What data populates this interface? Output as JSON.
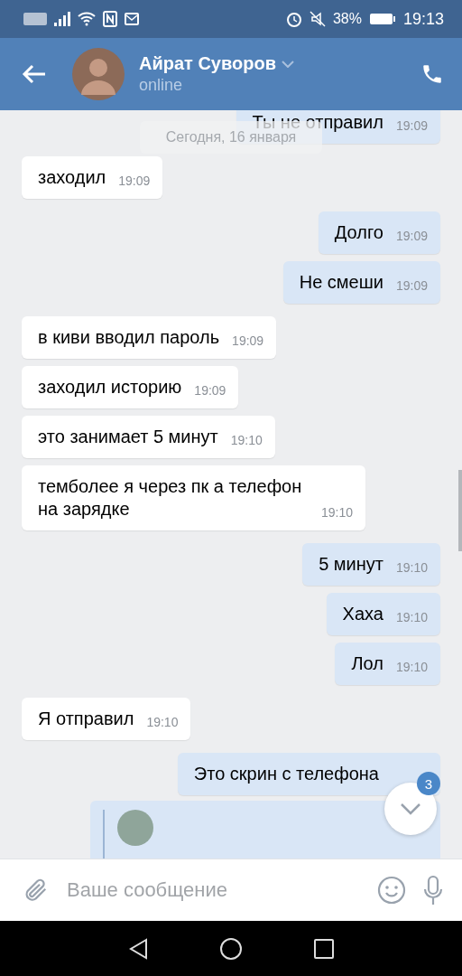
{
  "status_bar": {
    "battery": "38%",
    "time": "19:13"
  },
  "header": {
    "name": "Айрат Суворов",
    "status": "online"
  },
  "date_pill": "Сегодня, 16 января",
  "messages": [
    {
      "kind": "outgoing",
      "text": "Ты не отправил",
      "time": "19:09"
    },
    {
      "kind": "incoming",
      "text": "заходил",
      "time": "19:09"
    },
    {
      "kind": "outgoing",
      "text": "Долго",
      "time": "19:09"
    },
    {
      "kind": "outgoing",
      "text": "Не смеши",
      "time": "19:09"
    },
    {
      "kind": "incoming",
      "text": "в киви вводил пароль",
      "time": "19:09"
    },
    {
      "kind": "incoming",
      "text": "заходил историю",
      "time": "19:09"
    },
    {
      "kind": "incoming",
      "text": "это занимает 5 минут",
      "time": "19:10"
    },
    {
      "kind": "incoming",
      "text": "темболее я через пк а телефон на зарядке",
      "time": "19:10"
    },
    {
      "kind": "outgoing",
      "text": "5 минут",
      "time": "19:10"
    },
    {
      "kind": "outgoing",
      "text": "Хаха",
      "time": "19:10"
    },
    {
      "kind": "outgoing",
      "text": "Лол",
      "time": "19:10"
    },
    {
      "kind": "incoming",
      "text": "Я отправил",
      "time": "19:10"
    },
    {
      "kind": "outgoing",
      "text": "Это скрин с телефона"
    },
    {
      "kind": "forwarded"
    }
  ],
  "scroll_button": {
    "badge": "3"
  },
  "composer": {
    "placeholder": "Ваше сообщение"
  }
}
